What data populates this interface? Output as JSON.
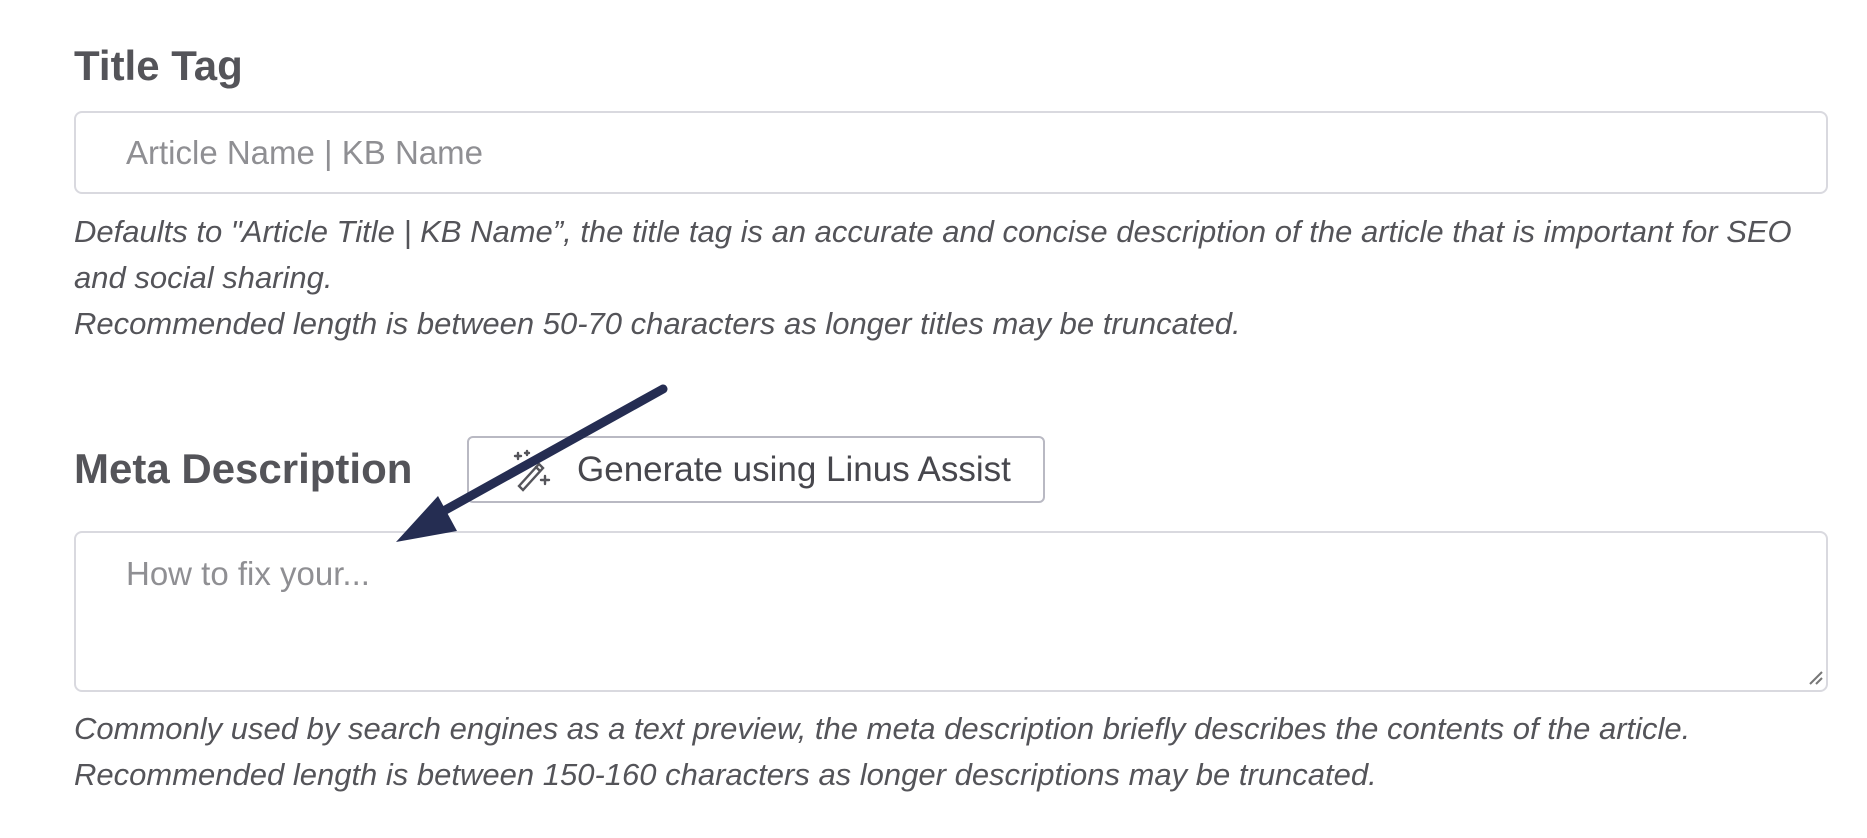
{
  "title_tag": {
    "heading": "Title Tag",
    "input_placeholder": "Article Name | KB Name",
    "input_value": "",
    "help_line_1": "Defaults to \"Article Title | KB Name”, the title tag is an accurate and concise description of the article that is important for SEO and social sharing.",
    "help_line_2": "Recommended length is between 50-70 characters as longer titles may be truncated."
  },
  "meta_description": {
    "heading": "Meta Description",
    "generate_button_label": "Generate using Linus Assist",
    "generate_button_icon": "magic-wand-sparkles-icon",
    "textarea_placeholder": "How to fix your...",
    "textarea_value": "",
    "help_line_1": "Commonly used by search engines as a text preview, the meta description briefly describes the contents of the article.",
    "help_line_2": "Recommended length is between 150-160 characters as longer descriptions may be truncated."
  },
  "annotation": {
    "arrow_color": "#252d52",
    "icon_name": "annotation-arrow-icon"
  },
  "colors": {
    "text": "#545459",
    "border": "#d9d9df",
    "placeholder": "#8f8f93"
  }
}
